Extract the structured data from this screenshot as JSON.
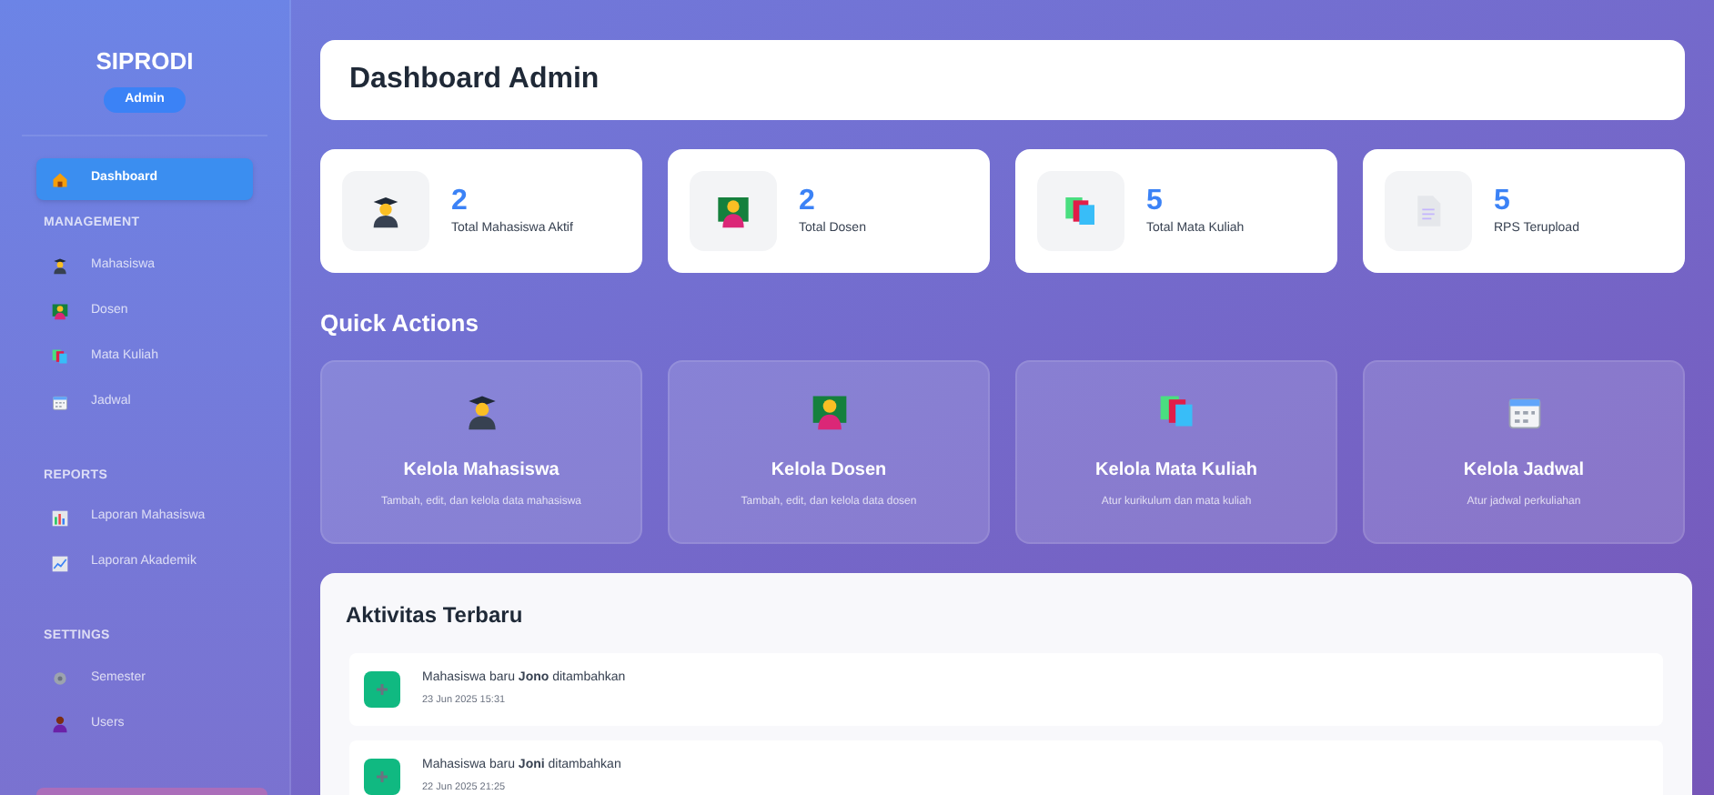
{
  "sidebar": {
    "brand": "SIPRODI",
    "role_badge": "Admin",
    "sections": [
      {
        "items": [
          {
            "label": "Dashboard",
            "kind": "home",
            "selected": true
          }
        ]
      },
      {
        "title": "MANAGEMENT",
        "items": [
          {
            "label": "Mahasiswa",
            "kind": "student",
            "selected": false
          },
          {
            "label": "Dosen",
            "kind": "teacher",
            "selected": false
          },
          {
            "label": "Mata Kuliah",
            "kind": "books",
            "selected": false
          },
          {
            "label": "Jadwal",
            "kind": "calendar",
            "selected": false
          }
        ]
      },
      {
        "title": "REPORTS",
        "items": [
          {
            "label": "Laporan Mahasiswa",
            "kind": "chart",
            "selected": false
          },
          {
            "label": "Laporan Akademik",
            "kind": "trend",
            "selected": false
          }
        ]
      },
      {
        "title": "SETTINGS",
        "items": [
          {
            "label": "Semester",
            "kind": "gear",
            "selected": false
          },
          {
            "label": "Users",
            "kind": "user",
            "selected": false
          }
        ]
      }
    ]
  },
  "header": {
    "title": "Dashboard Admin"
  },
  "stats": [
    {
      "value": "2",
      "label": "Total Mahasiswa Aktif",
      "kind": "student"
    },
    {
      "value": "2",
      "label": "Total Dosen",
      "kind": "teacher"
    },
    {
      "value": "5",
      "label": "Total Mata Kuliah",
      "kind": "books"
    },
    {
      "value": "5",
      "label": "RPS Terupload",
      "kind": "document"
    }
  ],
  "quick_actions": {
    "title": "Quick Actions",
    "items": [
      {
        "title": "Kelola Mahasiswa",
        "description": "Tambah, edit, dan kelola data mahasiswa",
        "kind": "student"
      },
      {
        "title": "Kelola Dosen",
        "description": "Tambah, edit, dan kelola data dosen",
        "kind": "teacher"
      },
      {
        "title": "Kelola Mata Kuliah",
        "description": "Atur kurikulum dan mata kuliah",
        "kind": "books"
      },
      {
        "title": "Kelola Jadwal",
        "description": "Atur jadwal perkuliahan",
        "kind": "calendar"
      }
    ]
  },
  "recent_activity": {
    "title": "Aktivitas Terbaru",
    "items": [
      {
        "text": "Mahasiswa baru **Jono** ditambahkan",
        "time": "23 Jun 2025 15:31"
      },
      {
        "text": "Mahasiswa baru **Joni** ditambahkan",
        "time": "22 Jun 2025 21:25"
      }
    ]
  }
}
